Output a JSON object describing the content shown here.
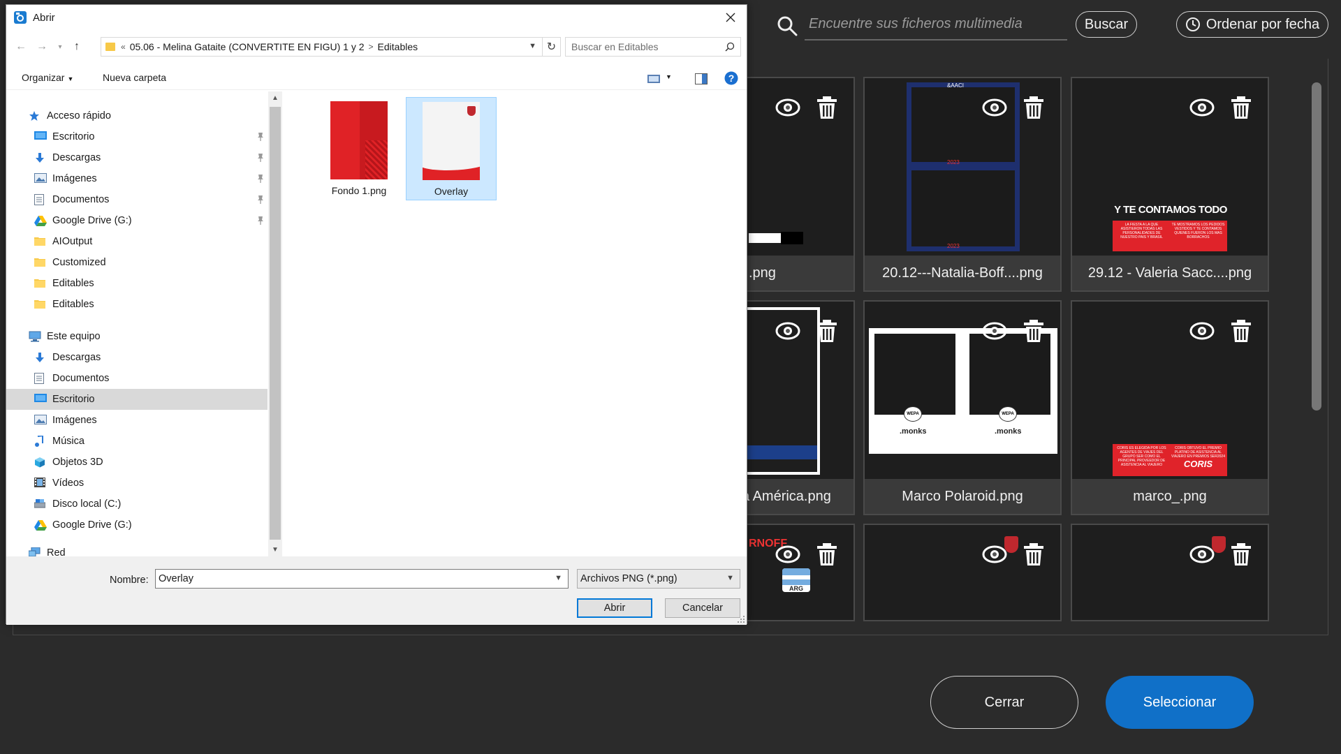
{
  "background": {
    "search": {
      "placeholder": "Encuentre sus ficheros multimedia"
    },
    "buttons": {
      "search": "Buscar",
      "order": "Ordenar por fecha",
      "close": "Cerrar",
      "select": "Seleccionar"
    },
    "cards": [
      {
        "caption": ".png",
        "thumb": "partial-white"
      },
      {
        "caption": "20.12---Natalia-Boff....png",
        "thumb": "blue-frame"
      },
      {
        "caption": "29.12 - Valeria Sacc....png",
        "thumb": "red-banner"
      },
      {
        "caption": "a América.png",
        "thumb": "white-frame"
      },
      {
        "caption": "Marco Polaroid.png",
        "thumb": "polaroid"
      },
      {
        "caption": "marco_.png",
        "thumb": "red-banner-2"
      },
      {
        "caption": "",
        "thumb": "arg-flag"
      },
      {
        "caption": "",
        "thumb": "dark"
      },
      {
        "caption": "",
        "thumb": "dark"
      }
    ],
    "thumb_texts": {
      "aaci": "&AACI",
      "year": "2023",
      "headline": "Y TE CONTAMOS TODO",
      "banner_left": "LA FIESTA A LA QUE ASISTIERON TODAS LAS PERSONALIDADES DE NUESTRO PAIS Y BRASIL",
      "banner_right": "TE MOSTRAMOS LOS PEDIDOS VESTIDOS Y TE CONTAMOS QUIENES FUERON LOS MAS BORRACHOS",
      "monks": ".monks",
      "wepa": "WEPA",
      "coris": "CORIS",
      "coris_left": "CORIS ES ELEGIDA POR LOS AGENTES DE VIAJES DEL GRUPO SER COMO EL PRINCIPAL PROVEEDOR DE ASISTENCIA AL VIAJERO",
      "coris_right": "CORIS OBTUVO EL PREMIO PLATINO DE ASISTENCIA AL VIAJERO EN PREMIOS SER2024",
      "arg": "ARG",
      "ornoff": "RNOFF"
    },
    "colors": {
      "accent": "#1070c8",
      "bg": "#2b2b2b"
    }
  },
  "dialog": {
    "title": "Abrir",
    "address": {
      "chevrons": "«",
      "folder": "05.06 - Melina Gataite (CONVERTITE EN FIGU) 1 y 2",
      "sep": ">",
      "subfolder": "Editables"
    },
    "search_placeholder": "Buscar en Editables",
    "toolbar": {
      "organize": "Organizar",
      "new_folder": "Nueva carpeta"
    },
    "nav": [
      {
        "label": "Acceso rápido",
        "icon": "star-icon",
        "indent": 0,
        "pinned": false
      },
      {
        "label": "Escritorio",
        "icon": "desktop-icon",
        "indent": 1,
        "pinned": true
      },
      {
        "label": "Descargas",
        "icon": "download-icon",
        "indent": 1,
        "pinned": true
      },
      {
        "label": "Imágenes",
        "icon": "pictures-icon",
        "indent": 1,
        "pinned": true
      },
      {
        "label": "Documentos",
        "icon": "documents-icon",
        "indent": 1,
        "pinned": true
      },
      {
        "label": "Google Drive (G:)",
        "icon": "google-drive-icon",
        "indent": 1,
        "pinned": true
      },
      {
        "label": "AIOutput",
        "icon": "folder-icon",
        "indent": 1,
        "pinned": false
      },
      {
        "label": "Customized",
        "icon": "folder-icon",
        "indent": 1,
        "pinned": false
      },
      {
        "label": "Editables",
        "icon": "folder-icon",
        "indent": 1,
        "pinned": false
      },
      {
        "label": "Editables",
        "icon": "folder-icon",
        "indent": 1,
        "pinned": false
      },
      {
        "label": "Este equipo",
        "icon": "computer-icon",
        "indent": 0,
        "pinned": false
      },
      {
        "label": "Descargas",
        "icon": "download-icon",
        "indent": 1,
        "pinned": false
      },
      {
        "label": "Documentos",
        "icon": "documents-icon",
        "indent": 1,
        "pinned": false
      },
      {
        "label": "Escritorio",
        "icon": "desktop-icon",
        "indent": 1,
        "pinned": false,
        "selected": true
      },
      {
        "label": "Imágenes",
        "icon": "pictures-icon",
        "indent": 1,
        "pinned": false
      },
      {
        "label": "Música",
        "icon": "music-icon",
        "indent": 1,
        "pinned": false
      },
      {
        "label": "Objetos 3D",
        "icon": "cube-icon",
        "indent": 1,
        "pinned": false
      },
      {
        "label": "Vídeos",
        "icon": "video-icon",
        "indent": 1,
        "pinned": false
      },
      {
        "label": "Disco local (C:)",
        "icon": "disk-icon",
        "indent": 1,
        "pinned": false
      },
      {
        "label": "Google Drive (G:)",
        "icon": "google-drive-icon",
        "indent": 1,
        "pinned": false
      },
      {
        "label": "Red",
        "icon": "network-icon",
        "indent": 0,
        "pinned": false
      }
    ],
    "files": [
      {
        "name": "Fondo 1.png",
        "selected": false
      },
      {
        "name": "Overlay",
        "selected": true
      }
    ],
    "filename_label": "Nombre:",
    "filename_value": "Overlay",
    "filetype": "Archivos PNG (*.png)",
    "buttons": {
      "open": "Abrir",
      "cancel": "Cancelar"
    }
  }
}
